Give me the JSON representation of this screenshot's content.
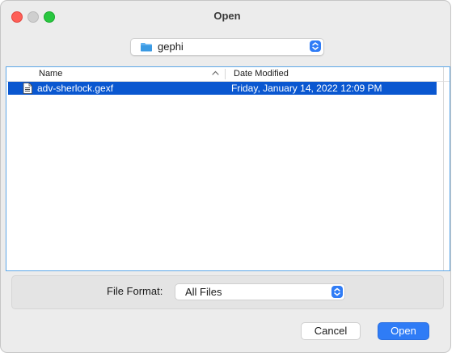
{
  "window": {
    "title": "Open"
  },
  "location": {
    "folder_name": "gephi"
  },
  "file_list": {
    "columns": [
      "Name",
      "Date Modified"
    ],
    "rows": [
      {
        "name": "adv-sherlock.gexf",
        "date_modified": "Friday, January 14, 2022 12:09 PM",
        "selected": true
      }
    ]
  },
  "format": {
    "label": "File Format:",
    "value": "All Files"
  },
  "buttons": {
    "cancel": "Cancel",
    "open": "Open"
  },
  "colors": {
    "selection": "#0a57d0",
    "accent": "#2f7cf6"
  },
  "icons": {
    "folder": "folder-icon",
    "file": "document-icon",
    "sort": "chevron-up-icon",
    "popup": "up-down-arrows-icon"
  }
}
